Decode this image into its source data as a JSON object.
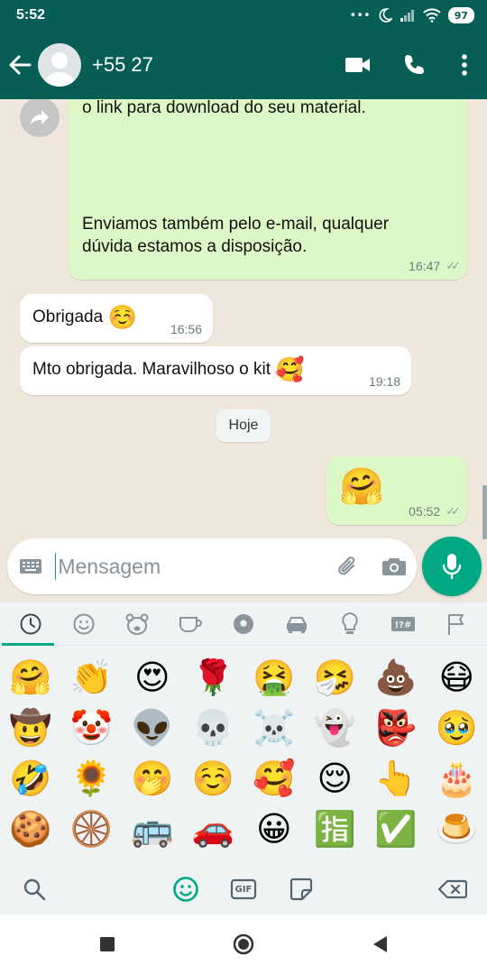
{
  "status_bar": {
    "time": "5:52",
    "battery": "97"
  },
  "app_bar": {
    "contact_name": "+55 27"
  },
  "messages": [
    {
      "direction": "outgoing",
      "text_line1": "o link para download do seu material.",
      "text_line2": "Enviamos também pelo e-mail, qualquer",
      "text_line3": "dúvida estamos a disposição.",
      "time": "16:47"
    },
    {
      "direction": "incoming",
      "text": "Obrigada",
      "emoji": "☺️",
      "time": "16:56"
    },
    {
      "direction": "incoming",
      "text": "Mto obrigada. Maravilhoso o kit",
      "emoji": "🥰",
      "time": "19:18"
    },
    {
      "direction": "outgoing",
      "emoji": "🤗",
      "time": "05:52"
    }
  ],
  "date_chip": "Hoje",
  "composer": {
    "placeholder": "Mensagem"
  },
  "emoji_panel": {
    "categories": [
      "recent-icon",
      "smiley-icon",
      "animal-icon",
      "food-icon",
      "activity-icon",
      "travel-icon",
      "objects-icon",
      "symbols-icon",
      "flags-icon"
    ],
    "emojis": [
      "🤗",
      "👏",
      "😍",
      "🌹",
      "🤮",
      "🤧",
      "💩",
      "😷",
      "🤠",
      "🤡",
      "👽",
      "💀",
      "☠️",
      "👻",
      "👺",
      "🥹",
      "🤣",
      "🌻",
      "🤭",
      "☺️",
      "🥰",
      "😌",
      "👆",
      "🎂",
      "🍪",
      "🛞",
      "🚌",
      "🚗",
      "😀",
      "🈯",
      "✅",
      "🍮"
    ],
    "gif_label": "GIF"
  },
  "colors": {
    "header": "#075e54",
    "accent": "#00a884",
    "outgoing_bubble": "#dcf8c6"
  }
}
